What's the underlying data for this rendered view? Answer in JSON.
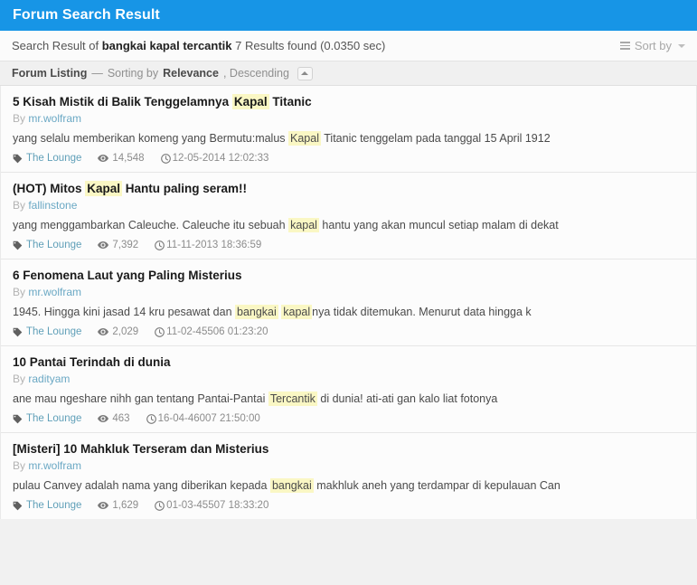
{
  "header": {
    "title": "Forum Search Result",
    "accent_color": "#1795e6"
  },
  "summary": {
    "prefix": "Search Result of",
    "query": "bangkai kapal tercantik",
    "suffix": "7 Results found (0.0350 sec)",
    "sort_label": "Sort by",
    "sort_icon": "list-icon",
    "caret_icon": "chevron-down-icon"
  },
  "listing": {
    "title": "Forum Listing",
    "dash": "—",
    "sorting_prefix": "Sorting by",
    "sort_field": "Relevance",
    "sort_direction": ", Descending",
    "collapse_icon": "chevron-up-icon"
  },
  "meta_icons": {
    "forum": "tag-icon",
    "views": "eye-icon",
    "date": "clock-icon"
  },
  "labels": {
    "by": "By"
  },
  "highlight_color": "#faf7c4",
  "link_color": "#5f9fb8",
  "results": [
    {
      "title_parts": [
        {
          "text": "5 Kisah Mistik di Balik Tenggelamnya ",
          "highlight": false
        },
        {
          "text": "Kapal",
          "highlight": true
        },
        {
          "text": " Titanic",
          "highlight": false
        }
      ],
      "author": "mr.wolfram",
      "snippet_parts": [
        {
          "text": "yang selalu memberikan komeng yang Bermutu:malus ",
          "highlight": false
        },
        {
          "text": "Kapal",
          "highlight": true
        },
        {
          "text": " Titanic tenggelam pada tanggal 15 April 1912",
          "highlight": false
        }
      ],
      "forum": "The Lounge",
      "views": "14,548",
      "date": "12-05-2014 12:02:33"
    },
    {
      "title_parts": [
        {
          "text": "(HOT) Mitos ",
          "highlight": false
        },
        {
          "text": "Kapal",
          "highlight": true
        },
        {
          "text": " Hantu paling seram!!",
          "highlight": false
        }
      ],
      "author": "fallinstone",
      "snippet_parts": [
        {
          "text": "yang menggambarkan Caleuche. Caleuche itu sebuah ",
          "highlight": false
        },
        {
          "text": "kapal",
          "highlight": true
        },
        {
          "text": " hantu yang akan muncul setiap malam di dekat",
          "highlight": false
        }
      ],
      "forum": "The Lounge",
      "views": "7,392",
      "date": "11-11-2013 18:36:59"
    },
    {
      "title_parts": [
        {
          "text": "6 Fenomena Laut yang Paling Misterius",
          "highlight": false
        }
      ],
      "author": "mr.wolfram",
      "snippet_parts": [
        {
          "text": "1945. Hingga kini jasad 14 kru pesawat dan ",
          "highlight": false
        },
        {
          "text": "bangkai",
          "highlight": true
        },
        {
          "text": " ",
          "highlight": false
        },
        {
          "text": "kapal",
          "highlight": true
        },
        {
          "text": "nya tidak ditemukan. Menurut data hingga k",
          "highlight": false
        }
      ],
      "forum": "The Lounge",
      "views": "2,029",
      "date": "11-02-45506 01:23:20"
    },
    {
      "title_parts": [
        {
          "text": "10 Pantai Terindah di dunia",
          "highlight": false
        }
      ],
      "author": "radityam",
      "snippet_parts": [
        {
          "text": "ane mau ngeshare nihh gan tentang Pantai-Pantai ",
          "highlight": false
        },
        {
          "text": "Tercantik",
          "highlight": true
        },
        {
          "text": " di dunia! ati-ati gan kalo liat fotonya",
          "highlight": false
        }
      ],
      "forum": "The Lounge",
      "views": "463",
      "date": "16-04-46007 21:50:00"
    },
    {
      "title_parts": [
        {
          "text": "[Misteri] 10 Mahkluk Terseram dan Misterius",
          "highlight": false
        }
      ],
      "author": "mr.wolfram",
      "snippet_parts": [
        {
          "text": "pulau Canvey adalah nama yang diberikan kepada ",
          "highlight": false
        },
        {
          "text": "bangkai",
          "highlight": true
        },
        {
          "text": " makhluk aneh yang terdampar di kepulauan Can",
          "highlight": false
        }
      ],
      "forum": "The Lounge",
      "views": "1,629",
      "date": "01-03-45507 18:33:20"
    }
  ]
}
